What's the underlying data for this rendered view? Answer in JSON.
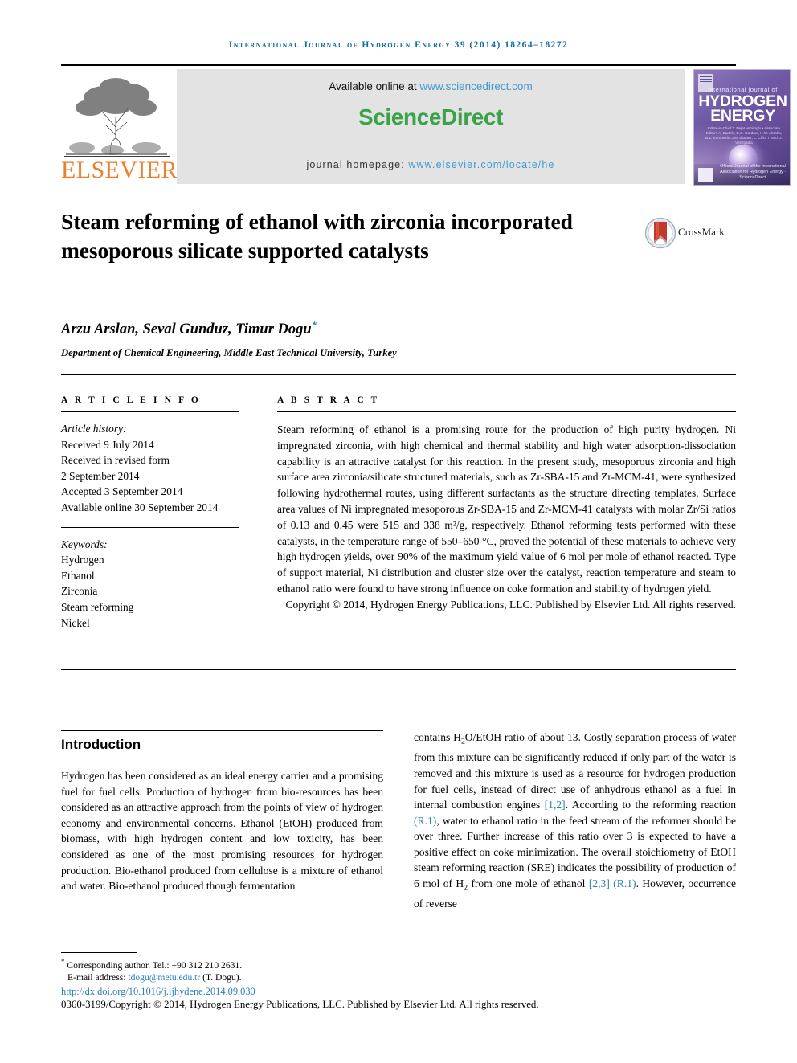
{
  "running_head": "International Journal of Hydrogen Energy 39 (2014) 18264–18272",
  "masthead": {
    "publisher_name": "ELSEVIER",
    "available_prefix": "Available online at ",
    "available_url": "www.sciencedirect.com",
    "sciencedirect_logo": "ScienceDirect",
    "homepage_prefix": "journal homepage: ",
    "homepage_url": "www.elsevier.com/locate/he"
  },
  "cover": {
    "intl_line": "international journal of",
    "title_line1": "HYDROGEN",
    "title_line2": "ENERGY",
    "editors": "Editor-in-Chief  T. Nejat Veziroglu  •  Associate Editors  A. Bartels, D.C. Gardner, H.W. Abraha, B.Z. Kuronskis, J.M. Ibarbez, L. Chiu, T. and G. Vezirgadja",
    "bottom_note": "Official Journal of the International Association for Hydrogen Energy  ·  ScienceDirect"
  },
  "crossmark": {
    "label": "CrossMark"
  },
  "article": {
    "title": "Steam reforming of ethanol with zirconia incorporated mesoporous silicate supported catalysts",
    "authors": "Arzu Arslan, Seval Gunduz, Timur Dogu",
    "author_star": "*",
    "affiliation": "Department of Chemical Engineering, Middle East Technical University, Turkey"
  },
  "article_info": {
    "heading": "A R T I C L E   I N F O",
    "history_label": "Article history:",
    "history_lines": [
      "Received 9 July 2014",
      "Received in revised form",
      "2 September 2014",
      "Accepted 3 September 2014",
      "Available online 30 September 2014"
    ],
    "keywords_label": "Keywords:",
    "keywords": [
      "Hydrogen",
      "Ethanol",
      "Zirconia",
      "Steam reforming",
      "Nickel"
    ]
  },
  "abstract": {
    "heading": "A B S T R A C T",
    "text": "Steam reforming of ethanol is a promising route for the production of high purity hydrogen. Ni impregnated zirconia, with high chemical and thermal stability and high water adsorption-dissociation capability is an attractive catalyst for this reaction. In the present study, mesoporous zirconia and high surface area zirconia/silicate structured materials, such as Zr-SBA-15 and Zr-MCM-41, were synthesized following hydrothermal routes, using different surfactants as the structure directing templates. Surface area values of Ni impregnated mesoporous Zr-SBA-15 and Zr-MCM-41 catalysts with molar Zr/Si ratios of 0.13 and 0.45 were 515 and 338 m²/g, respectively. Ethanol reforming tests performed with these catalysts, in the temperature range of 550–650 °C, proved the potential of these materials to achieve very high hydrogen yields, over 90% of the maximum yield value of 6 mol per mole of ethanol reacted. Type of support material, Ni distribution and cluster size over the catalyst, reaction temperature and steam to ethanol ratio were found to have strong influence on coke formation and stability of hydrogen yield.",
    "copyright": "Copyright © 2014, Hydrogen Energy Publications, LLC. Published by Elsevier Ltd. All rights reserved."
  },
  "introduction": {
    "heading": "Introduction",
    "left_column": "Hydrogen has been considered as an ideal energy carrier and a promising fuel for fuel cells. Production of hydrogen from bio-resources has been considered as an attractive approach from the points of view of hydrogen economy and environmental concerns. Ethanol (EtOH) produced from biomass, with high hydrogen content and low toxicity, has been considered as one of the most promising resources for hydrogen production. Bio-ethanol produced from cellulose is a mixture of ethanol and water. Bio-ethanol produced though fermentation",
    "right_column_part1": "contains H",
    "right_column_sub1": "2",
    "right_column_part2": "O/EtOH ratio of about 13. Costly separation process of water from this mixture can be significantly reduced if only part of the water is removed and this mixture is used as a resource for hydrogen production for fuel cells, instead of direct use of anhydrous ethanol as a fuel in internal combustion engines ",
    "cite_1": "[1,2]",
    "right_column_part3": ". According to the reforming reaction ",
    "cite_2": "(R.1)",
    "right_column_part4": ", water to ethanol ratio in the feed stream of the reformer should be over three. Further increase of this ratio over 3 is expected to have a positive effect on coke minimization. The overall stoichiometry of EtOH steam reforming reaction (SRE) indicates the possibility of production of 6 mol of H",
    "right_column_sub2": "2",
    "right_column_part5": " from one mole of ethanol ",
    "cite_3": "[2,3]",
    "right_column_part6": " ",
    "cite_4": "(R.1)",
    "right_column_part7": ". However, occurrence of reverse"
  },
  "footer": {
    "corresponding": "Corresponding author. Tel.: +90 312 210 2631.",
    "email_label": "E-mail address: ",
    "email": "tdogu@metu.edu.tr",
    "email_suffix": " (T. Dogu).",
    "doi": "http://dx.doi.org/10.1016/j.ijhydene.2014.09.030",
    "issn_line": "0360-3199/Copyright © 2014, Hydrogen Energy Publications, LLC. Published by Elsevier Ltd. All rights reserved."
  },
  "colors": {
    "header_blue": "#0f6ca8",
    "link_blue": "#3f9bd0",
    "cite_blue": "#2b7fb8",
    "elsevier_orange": "#eb7f2b",
    "sciencedirect_green": "#3aa34a"
  }
}
